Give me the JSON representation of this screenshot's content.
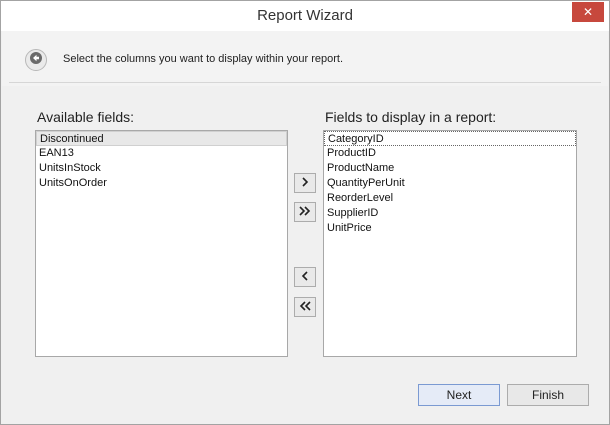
{
  "window": {
    "title": "Report Wizard",
    "close_glyph": "✕"
  },
  "header": {
    "back_icon": "arrow-left-icon",
    "instruction": "Select the columns you want to display within your report."
  },
  "available": {
    "label": "Available fields:",
    "items": [
      "Discontinued",
      "EAN13",
      "UnitsInStock",
      "UnitsOnOrder"
    ]
  },
  "selected": {
    "label": "Fields to display in a report:",
    "items": [
      "CategoryID",
      "ProductID",
      "ProductName",
      "QuantityPerUnit",
      "ReorderLevel",
      "SupplierID",
      "UnitPrice"
    ]
  },
  "move_buttons": {
    "add_icon": "chevron-right-icon",
    "add_all_icon": "double-chevron-right-icon",
    "remove_icon": "chevron-left-icon",
    "remove_all_icon": "double-chevron-left-icon"
  },
  "footer": {
    "next_label": "Next",
    "finish_label": "Finish"
  },
  "colors": {
    "close_button": "#c7483d",
    "primary_border": "#7b9ad2"
  }
}
